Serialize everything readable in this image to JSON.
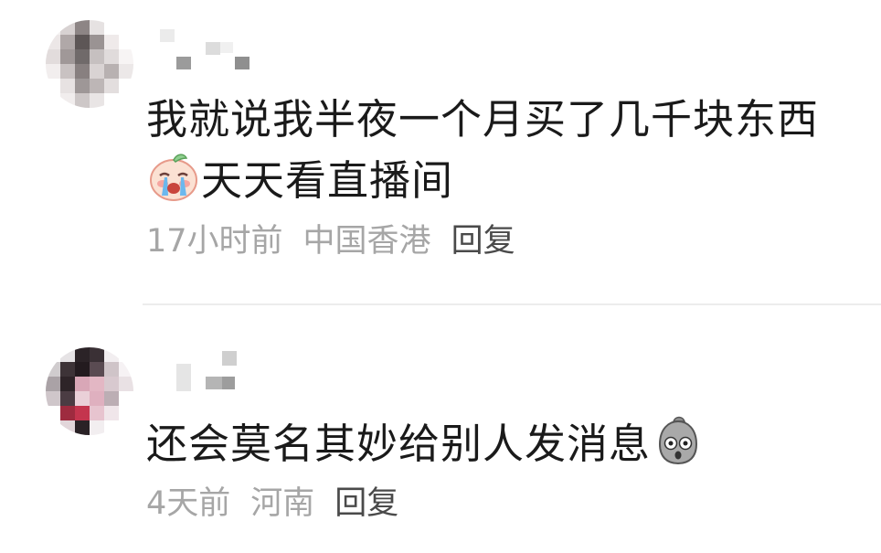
{
  "comments": [
    {
      "text_before_emoji": "我就说我半夜一个月买了几千块东西",
      "emoji": "crying-face-icon",
      "text_after_emoji": "天天看直播间",
      "time": "17小时前",
      "location": "中国香港",
      "reply_label": "回复"
    },
    {
      "text_before_emoji": "还会莫名其妙给别人发消息",
      "emoji": "shocked-face-icon",
      "text_after_emoji": "",
      "time": "4天前",
      "location": "河南",
      "reply_label": "回复"
    }
  ],
  "colors": {
    "comment_text": "#1a1a1a",
    "meta_text": "#a6a6a6",
    "reply_text": "#4a4a4a",
    "divider": "#ececec"
  }
}
